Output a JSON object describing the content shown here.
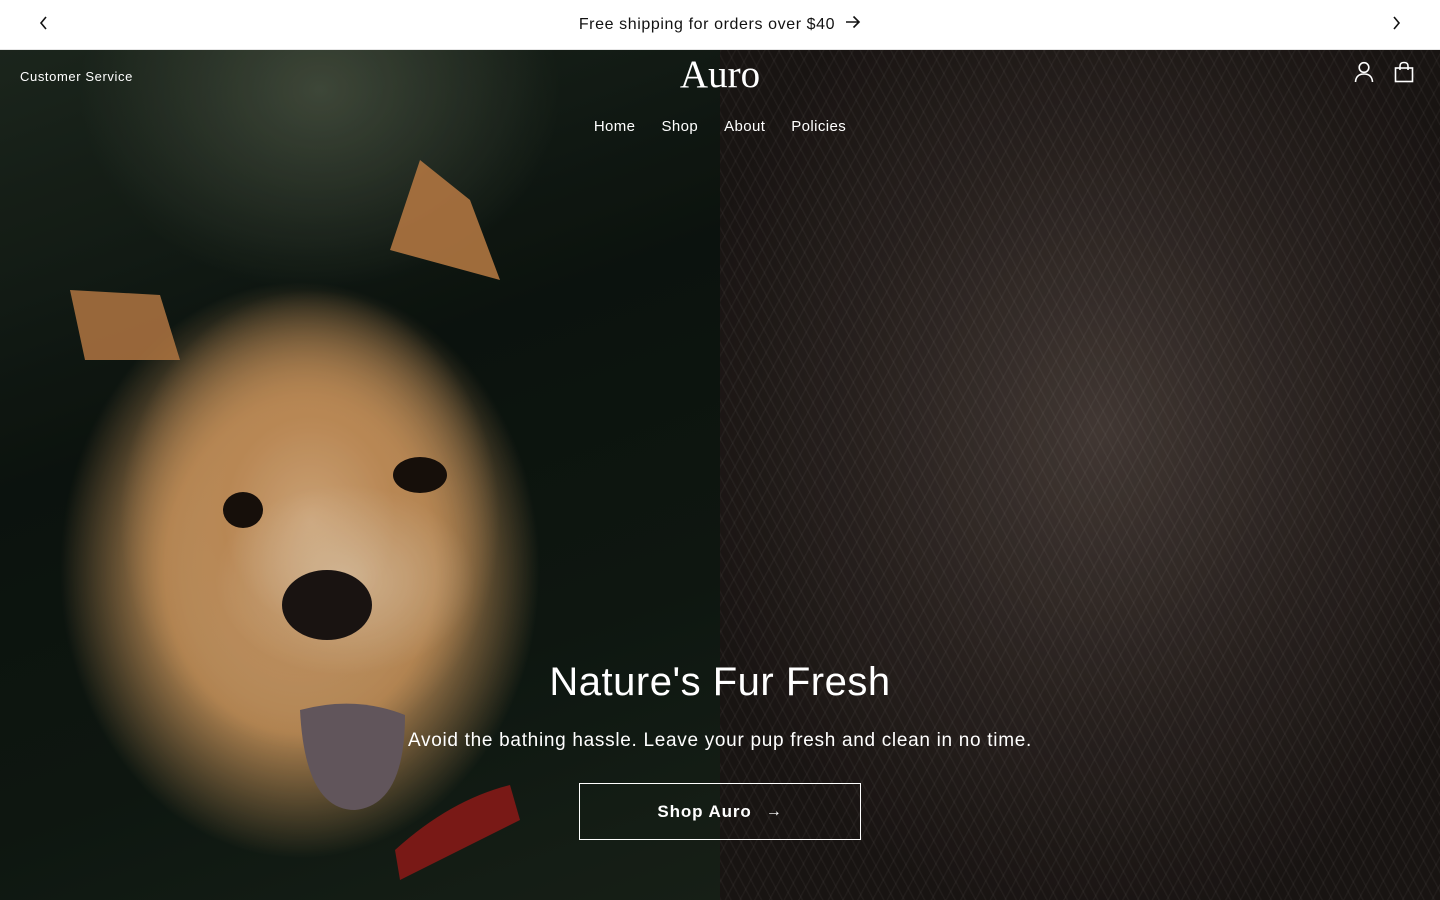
{
  "announcement": {
    "text": "Free shipping for orders over $40",
    "prev_icon": "chevron-left-icon",
    "next_icon": "chevron-right-icon",
    "arrow_icon": "arrow-right-icon"
  },
  "header": {
    "customer_service": "Customer Service",
    "logo": "Auro",
    "nav": [
      {
        "label": "Home"
      },
      {
        "label": "Shop"
      },
      {
        "label": "About"
      },
      {
        "label": "Policies"
      }
    ],
    "icons": [
      "account-icon",
      "cart-icon"
    ]
  },
  "hero": {
    "title": "Nature's Fur Fresh",
    "subtitle": "Avoid the bathing hassle. Leave your pup fresh and clean in no time.",
    "cta_label": "Shop Auro",
    "cta_arrow": "→"
  },
  "colors": {
    "announcement_bg": "#ffffff",
    "text_dark": "#121212",
    "hero_text": "#ffffff"
  }
}
